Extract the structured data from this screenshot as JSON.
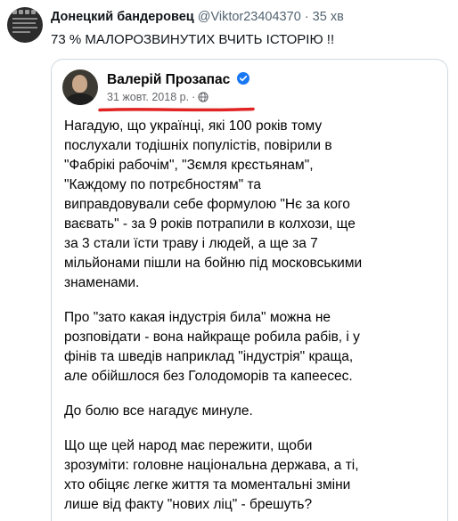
{
  "tweet": {
    "display_name": "Донецкий бандеровец",
    "handle": "@Viktor23404370",
    "separator": "·",
    "time": "35 хв",
    "text": "73 %  МАЛОРОЗВИНУТИХ ВЧИТЬ ІСТОРІЮ !!"
  },
  "quote": {
    "author": "Валерій Прозапас",
    "date": "31 жовт. 2018 р.",
    "date_separator": "·",
    "paragraphs": [
      "Нагадую, що українці, які 100 років тому\nпослухали тодішніх популістів, повірили в\n\"Фабрікі рабочім\", \"Зємля крєстьянам\",\n\"Каждому по потрєбностям\" та\nвиправдовували себе формулою \"Нє за кого\nваєвать\" - за 9 років потрапили в колхози, ще\nза 3 стали їсти траву і людей, а ще за 7\nмільйонами пішли на бойню під московськими\nзнаменами.",
      "Про \"зато какая індустрія била\"  можна не\nрозповідати - вона найкраще робила рабів, і у\nфінів та  шведів наприклад \"індустрія\" краща,\nале обійшлося без Голодоморів та капеесес.",
      "До болю все нагадує минуле.",
      "Що ще цей народ має пережити, щоби\nзрозуміти: головне національна держава, а ті,\nхто обіцяє легке життя та моментальні зміни\nлише від факту \"нових ліц\" - брешуть?"
    ]
  },
  "colors": {
    "verified": "#1877f2",
    "underline": "#e02424",
    "meta_text": "#536471"
  },
  "icons": {
    "verified": "verified-badge-icon",
    "privacy": "globe-icon"
  }
}
